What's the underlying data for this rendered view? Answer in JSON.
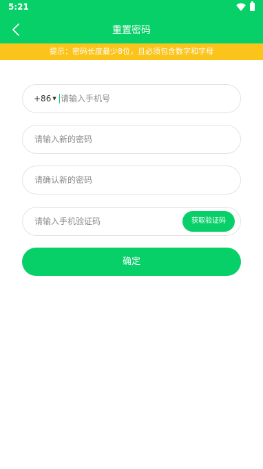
{
  "status_bar": {
    "time": "5:21",
    "wifi_icon": "wifi-icon",
    "battery_icon": "battery-icon"
  },
  "nav": {
    "title": "重置密码",
    "back_icon": "chevron-left-icon"
  },
  "hint": "提示：密码长度最少8位，且必须包含数字和字母",
  "form": {
    "country_code": "+86",
    "phone_placeholder": "请输入手机号",
    "new_password_placeholder": "请输入新的密码",
    "confirm_password_placeholder": "请确认新的密码",
    "sms_code_placeholder": "请输入手机验证码",
    "get_code_label": "获取验证码",
    "submit_label": "确定"
  },
  "colors": {
    "primary": "#08d068",
    "warning": "#fbc41a",
    "border": "#e3e3e3",
    "placeholder": "#8a8a8a"
  }
}
